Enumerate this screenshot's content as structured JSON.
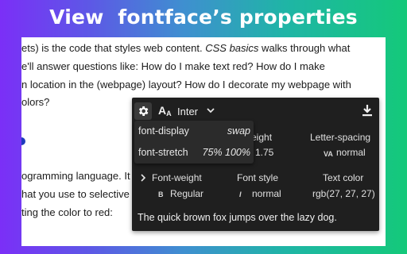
{
  "banner": {
    "title": "View  fontface’s properties"
  },
  "article": {
    "line1": "ets) is the code that styles web content. ",
    "line1_italic": "CSS basics",
    "line1_tail": " walks through what",
    "line2": "e'll answer questions like: How do I make text red? How do I make",
    "line3": "n location in the (webpage) layout? How do I decorate my webpage with",
    "line4": "olors?",
    "line5": "ogramming language. It",
    "line6": "hat you use to selective",
    "line7": "ting the color to red:"
  },
  "panel": {
    "font_name": "Inter",
    "font_icon": "A",
    "dropdown": {
      "items": [
        {
          "label": "font-display",
          "value": "swap"
        },
        {
          "label": "font-stretch",
          "value": "75% 100%"
        }
      ]
    },
    "row1": {
      "line_height_header": "eight",
      "line_height_value": "1.75",
      "letter_spacing_header": "Letter-spacing",
      "letter_spacing_icon": "VA",
      "letter_spacing_value": "normal"
    },
    "row2": {
      "font_weight_header": "Font-weight",
      "font_weight_icon": "B",
      "font_weight_value": "Regular",
      "font_style_header": "Font style",
      "font_style_icon": "I",
      "font_style_value": "normal",
      "text_color_header": "Text color",
      "text_color_value": "rgb(27, 27, 27)"
    },
    "sample_text": "The quick brown fox jumps over the lazy dog."
  },
  "icons": {
    "gear": "gear-icon",
    "font": "font-icon",
    "chevron": "chevron-down-icon",
    "download": "download-icon",
    "expand": "chevron-right-icon"
  },
  "colors": {
    "panel_bg": "#1f1f1f",
    "dropdown_bg": "#2b2b2b",
    "text_color_value": "#1b1b1b",
    "bullet": "#1d3bbd"
  }
}
